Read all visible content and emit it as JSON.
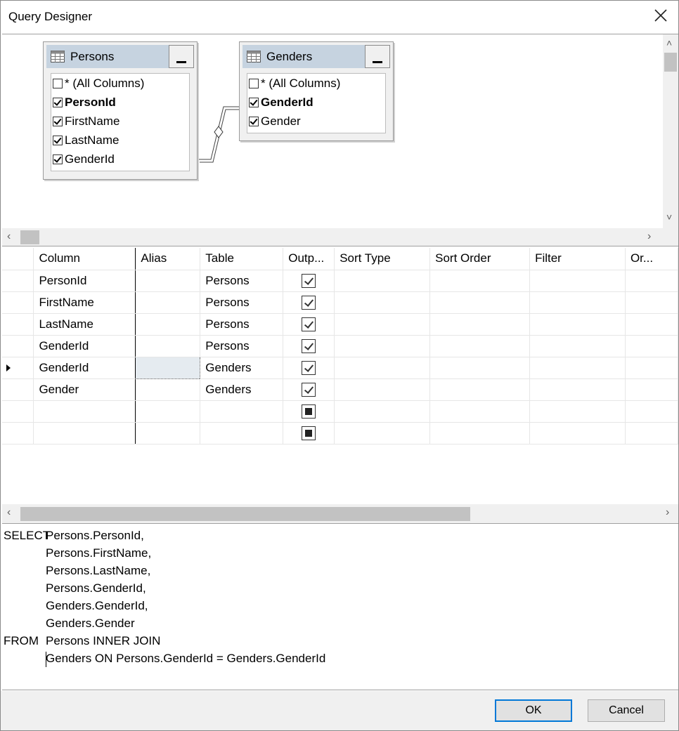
{
  "window": {
    "title": "Query Designer"
  },
  "diagram": {
    "tables": [
      {
        "name": "Persons",
        "columns": [
          {
            "label": "* (All Columns)",
            "checked": false,
            "bold": false
          },
          {
            "label": "PersonId",
            "checked": true,
            "bold": true
          },
          {
            "label": "FirstName",
            "checked": true,
            "bold": false
          },
          {
            "label": "LastName",
            "checked": true,
            "bold": false
          },
          {
            "label": "GenderId",
            "checked": true,
            "bold": false
          }
        ]
      },
      {
        "name": "Genders",
        "columns": [
          {
            "label": "* (All Columns)",
            "checked": false,
            "bold": false
          },
          {
            "label": "GenderId",
            "checked": true,
            "bold": true
          },
          {
            "label": "Gender",
            "checked": true,
            "bold": false
          }
        ]
      }
    ]
  },
  "grid": {
    "headers": [
      "Column",
      "Alias",
      "Table",
      "Outp...",
      "Sort Type",
      "Sort Order",
      "Filter",
      "Or..."
    ],
    "rows": [
      {
        "column": "PersonId",
        "alias": "",
        "table": "Persons",
        "output": "checked"
      },
      {
        "column": "FirstName",
        "alias": "",
        "table": "Persons",
        "output": "checked"
      },
      {
        "column": "LastName",
        "alias": "",
        "table": "Persons",
        "output": "checked"
      },
      {
        "column": "GenderId",
        "alias": "",
        "table": "Persons",
        "output": "checked"
      },
      {
        "column": "GenderId",
        "alias": "",
        "table": "Genders",
        "output": "checked",
        "current": true
      },
      {
        "column": "Gender",
        "alias": "",
        "table": "Genders",
        "output": "checked"
      },
      {
        "column": "",
        "alias": "",
        "table": "",
        "output": "indeterminate"
      },
      {
        "column": "",
        "alias": "",
        "table": "",
        "output": "indeterminate"
      }
    ]
  },
  "sql": {
    "lines": [
      {
        "kw": "SELECT",
        "text": "Persons.PersonId,"
      },
      {
        "kw": "",
        "text": "Persons.FirstName,"
      },
      {
        "kw": "",
        "text": "Persons.LastName,"
      },
      {
        "kw": "",
        "text": "Persons.GenderId,"
      },
      {
        "kw": "",
        "text": "Genders.GenderId,"
      },
      {
        "kw": "",
        "text": "Genders.Gender"
      },
      {
        "kw": "FROM",
        "text": "Persons INNER JOIN"
      },
      {
        "kw": "",
        "text": "Genders ON Persons.GenderId = Genders.GenderId"
      }
    ]
  },
  "footer": {
    "ok_label": "OK",
    "cancel_label": "Cancel"
  }
}
